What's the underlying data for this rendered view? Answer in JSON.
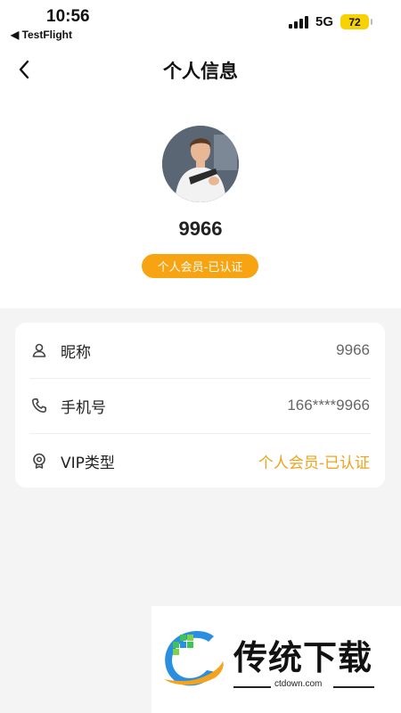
{
  "status_bar": {
    "time": "10:56",
    "back_app": "◀ TestFlight",
    "network": "5G",
    "battery": "72"
  },
  "nav": {
    "title": "个人信息",
    "back_icon": "chevron-left-icon"
  },
  "profile": {
    "avatar_icon": "user-avatar-photo",
    "username": "9966",
    "badge": "个人会员-已认证"
  },
  "info": {
    "rows": [
      {
        "icon": "person-icon",
        "label": "昵称",
        "value": "9966"
      },
      {
        "icon": "phone-icon",
        "label": "手机号",
        "value": "166****9966"
      },
      {
        "icon": "medal-icon",
        "label": "VIP类型",
        "value": "个人会员-已认证"
      }
    ]
  },
  "watermark": {
    "brand": "传统下载",
    "url": "ctdown.com"
  },
  "colors": {
    "accent": "#f7a312",
    "accent_text": "#f0a21c",
    "battery": "#f5d200",
    "background": "#f4f4f4"
  }
}
